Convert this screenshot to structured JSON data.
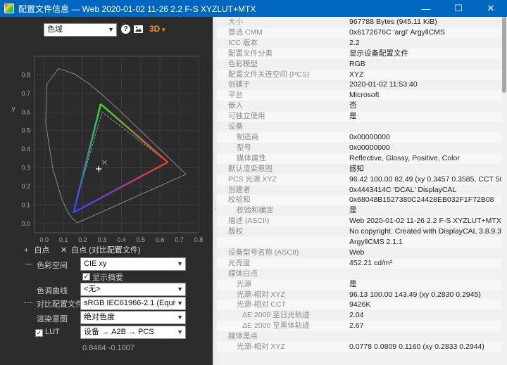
{
  "window": {
    "title": "配置文件信息 — Web 2020-01-02 11-26 2.2 F-S XYZLUT+MTX",
    "minimize": "—",
    "maximize": "☐",
    "close": "✕"
  },
  "toolbar": {
    "view_select": "色域",
    "help": "?",
    "threed": "3D"
  },
  "chart_data": {
    "type": "scatter",
    "xlabel": "x",
    "ylabel": "y",
    "xlim": [
      -0.05,
      0.8
    ],
    "ylim": [
      -0.05,
      0.9
    ],
    "x_ticks": [
      "0.0",
      "0.1",
      "0.2",
      "0.3",
      "0.4",
      "0.5",
      "0.6",
      "0.7",
      "0.8"
    ],
    "y_ticks": [
      "0.0",
      "0.1",
      "0.2",
      "0.3",
      "0.4",
      "0.5",
      "0.6",
      "0.7",
      "0.8"
    ],
    "x_tick_values": [
      0.0,
      0.1,
      0.2,
      0.3,
      0.4,
      0.5,
      0.6,
      0.7,
      0.8
    ],
    "y_tick_values": [
      0.0,
      0.1,
      0.2,
      0.3,
      0.4,
      0.5,
      0.6,
      0.7,
      0.8
    ],
    "grid": true,
    "spectral_locus": [
      [
        0.175,
        0.005
      ],
      [
        0.174,
        0.005
      ],
      [
        0.172,
        0.005
      ],
      [
        0.166,
        0.009
      ],
      [
        0.157,
        0.018
      ],
      [
        0.144,
        0.03
      ],
      [
        0.124,
        0.058
      ],
      [
        0.091,
        0.133
      ],
      [
        0.045,
        0.295
      ],
      [
        0.008,
        0.538
      ],
      [
        0.014,
        0.75
      ],
      [
        0.074,
        0.834
      ],
      [
        0.155,
        0.806
      ],
      [
        0.23,
        0.754
      ],
      [
        0.302,
        0.692
      ],
      [
        0.373,
        0.624
      ],
      [
        0.444,
        0.555
      ],
      [
        0.512,
        0.487
      ],
      [
        0.575,
        0.424
      ],
      [
        0.627,
        0.373
      ],
      [
        0.666,
        0.334
      ],
      [
        0.692,
        0.308
      ],
      [
        0.735,
        0.265
      ]
    ],
    "series": [
      {
        "name": "配置文件色域",
        "points": [
          [
            0.64,
            0.33
          ],
          [
            0.293,
            0.643
          ],
          [
            0.153,
            0.06
          ]
        ]
      },
      {
        "name": "sRGB IEC61966-2.1",
        "points": [
          [
            0.64,
            0.33
          ],
          [
            0.3,
            0.6
          ],
          [
            0.15,
            0.06
          ]
        ]
      }
    ],
    "white_point": [
      0.283,
      0.294
    ],
    "compare_white_point": [
      0.3127,
      0.329
    ]
  },
  "legend": {
    "white_point": "白点",
    "compare_white_point": "白点 (对比配置文件)"
  },
  "controls": {
    "colorspace_label": "色彩空间",
    "colorspace_value": "CIE xy",
    "show_summary_label": "显示摘要",
    "tone_curve_label": "色调曲线",
    "tone_curve_value": "<无>",
    "compare_label": "对比配置文件",
    "compare_value": "sRGB IEC61966-2.1 (Equivalen",
    "intent_label": "渲染意图",
    "intent_value": "绝对色度",
    "lut_label": "LUT",
    "lut_value": "设备 → A2B → PCS",
    "readout": "0.8484 -0.1007"
  },
  "info_rows": [
    {
      "key": "大小",
      "value": "967788 Bytes (945.11 KiB)"
    },
    {
      "key": "首选 CMM",
      "value": "0x6172676C 'argl' ArgyllCMS"
    },
    {
      "key": "ICC 版本",
      "value": "2.2"
    },
    {
      "key": "配置文件分类",
      "value": "显示设备配置文件"
    },
    {
      "key": "色彩模型",
      "value": "RGB"
    },
    {
      "key": "配置文件关连空间 (PCS)",
      "value": "XYZ"
    },
    {
      "key": "创建于",
      "value": "2020-01-02 11:53:40"
    },
    {
      "key": "平台",
      "value": "Microsoft"
    },
    {
      "key": "嵌入",
      "value": "否"
    },
    {
      "key": "可独立使用",
      "value": "是"
    },
    {
      "key": "设备",
      "value": ""
    },
    {
      "key": "制造商",
      "value": "0x00000000",
      "indent": 1
    },
    {
      "key": "型号",
      "value": "0x00000000",
      "indent": 1
    },
    {
      "key": "媒体属性",
      "value": "Reflective, Glossy, Positive, Color",
      "indent": 1
    },
    {
      "key": "默认渲染意图",
      "value": "感知"
    },
    {
      "key": "PCS 光源 XYZ",
      "value": "96.42 100.00  82.49 (xy 0.3457 0.3585, CCT 5000K)"
    },
    {
      "key": "创建者",
      "value": "0x4443414C 'DCAL' DisplayCAL"
    },
    {
      "key": "校验和",
      "value": "0x68048B1527380C24428EB032F1F72B08"
    },
    {
      "key": "校验和确定",
      "value": "是",
      "indent": 1
    },
    {
      "key": "描述 (ASCII)",
      "value": "Web 2020-01-02 11-26 2.2 F-S XYZLUT+MTX"
    },
    {
      "key": "版权",
      "value": "No copyright. Created with DisplayCAL 3.8.9.3 and"
    },
    {
      "key": "",
      "value": "ArgyllCMS 2.1.1"
    },
    {
      "key": "设备型号名称 (ASCII)",
      "value": "Web"
    },
    {
      "key": "光亮度",
      "value": "452.21 cd/m²"
    },
    {
      "key": "媒体白点",
      "value": ""
    },
    {
      "key": "光源",
      "value": "是",
      "indent": 1
    },
    {
      "key": "光源-相对 XYZ",
      "value": "96.13 100.00 143.49 (xy 0.2830 0.2945)",
      "indent": 1
    },
    {
      "key": "光源-相对 CCT",
      "value": "9426K",
      "indent": 1
    },
    {
      "key": "ΔE 2000 至日光轨迹",
      "value": "2.04",
      "indent": 2
    },
    {
      "key": "ΔE 2000 至黑体轨迹",
      "value": "2.67",
      "indent": 2
    },
    {
      "key": "媒体黑点",
      "value": ""
    },
    {
      "key": "光源-相对 XYZ",
      "value": "0.0778 0.0809 0.1160 (xy 0.2833 0.2944)",
      "indent": 1
    }
  ]
}
